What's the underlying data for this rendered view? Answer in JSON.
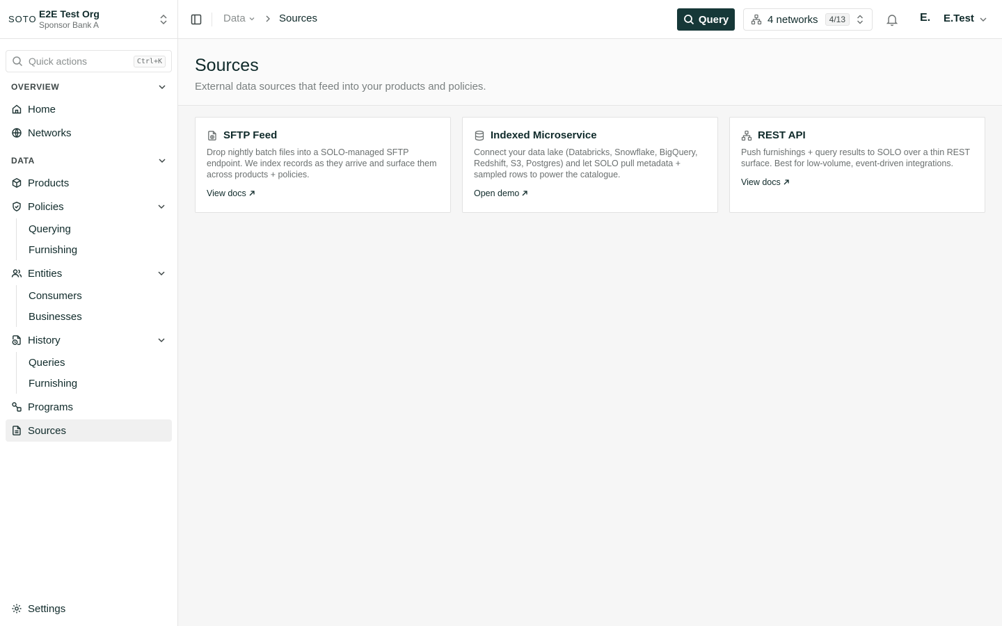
{
  "org": {
    "logo": "SOTO",
    "name": "E2E Test Org",
    "sub": "Sponsor Bank A"
  },
  "search": {
    "placeholder": "Quick actions",
    "shortcut": "Ctrl+K"
  },
  "sections": {
    "overview": "OVERVIEW",
    "data": "DATA"
  },
  "nav": {
    "home": "Home",
    "networks": "Networks",
    "products": "Products",
    "policies": "Policies",
    "policies_sub": [
      "Querying",
      "Furnishing"
    ],
    "entities": "Entities",
    "entities_sub": [
      "Consumers",
      "Businesses"
    ],
    "history": "History",
    "history_sub": [
      "Queries",
      "Furnishing"
    ],
    "programs": "Programs",
    "sources": "Sources",
    "settings": "Settings"
  },
  "topbar": {
    "crumb_parent": "Data",
    "crumb_current": "Sources",
    "query_label": "Query",
    "networks_label": "4 networks",
    "networks_badge": "4/13",
    "avatar": "E.",
    "user": "E.Test"
  },
  "page": {
    "title": "Sources",
    "subtitle": "External data sources that feed into your products and policies."
  },
  "cards": [
    {
      "title": "SFTP Feed",
      "icon": "file-upload-icon",
      "desc": "Drop nightly batch files into a SOLO-managed SFTP endpoint. We index records as they arrive and surface them across products + policies.",
      "link": "View docs"
    },
    {
      "title": "Indexed Microservice",
      "icon": "database-icon",
      "desc": "Connect your data lake (Databricks, Snowflake, BigQuery, Redshift, S3, Postgres) and let SOLO pull metadata + sampled rows to power the catalogue.",
      "link": "Open demo"
    },
    {
      "title": "REST API",
      "icon": "network-icon",
      "desc": "Push furnishings + query results to SOLO over a thin REST surface. Best for low-volume, event-driven integrations.",
      "link": "View docs"
    }
  ],
  "colors": {
    "primary": "#163838",
    "text": "#0f2a2a",
    "muted": "#6b7070",
    "active_bg": "#f0f0f0"
  }
}
